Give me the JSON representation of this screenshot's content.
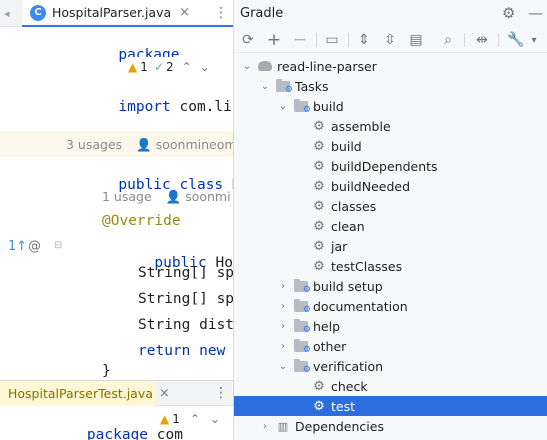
{
  "editor": {
    "tab_title": "HospitalParser.java",
    "tab_icon_letter": "C",
    "tab_close": "×",
    "tab_more": "⋮",
    "inspections": {
      "warnings": "1",
      "weak": "2"
    },
    "lines": [
      {
        "kw": "package",
        "rest": ""
      },
      {
        "kw": "import",
        "rest": " com.line.dom"
      },
      {
        "kw": "public class",
        "rest": " Hospit"
      },
      {
        "ann": "@Override"
      },
      {
        "kw": "public",
        "rest": " Hospital"
      },
      {
        "rest": "String[] sp"
      },
      {
        "rest": "String[] sp"
      },
      {
        "rest": "String dist"
      },
      {
        "kw": "return new",
        "rest": ""
      },
      {
        "rest": "}"
      }
    ],
    "hints": {
      "usages_1": "3 usages",
      "author_1": "soonmineom",
      "usages_2": "1 usage",
      "author_2": "soonmi"
    },
    "gutter_override": "1↑",
    "gutter_at": "@"
  },
  "editor2": {
    "tab_title": "HospitalParserTest.java",
    "tab_close": "×",
    "tab_more": "⋮",
    "code_kw": "package",
    "code_rest": " com",
    "inspection_count": "1"
  },
  "gradle": {
    "title": "Gradle",
    "tree": {
      "project": "read-line-parser",
      "tasks": "Tasks",
      "build_group": "build",
      "build_tasks": [
        "assemble",
        "build",
        "buildDependents",
        "buildNeeded",
        "classes",
        "clean",
        "jar",
        "testClasses"
      ],
      "build_setup": "build setup",
      "documentation": "documentation",
      "help": "help",
      "other": "other",
      "verification": "verification",
      "verification_tasks": [
        "check",
        "test"
      ],
      "dependencies": "Dependencies"
    },
    "selected_task": "test"
  },
  "colors": {
    "accent": "#3574f0",
    "selection": "#2c6ee0",
    "keyword": "#0033b3",
    "annotation": "#9e880d"
  }
}
